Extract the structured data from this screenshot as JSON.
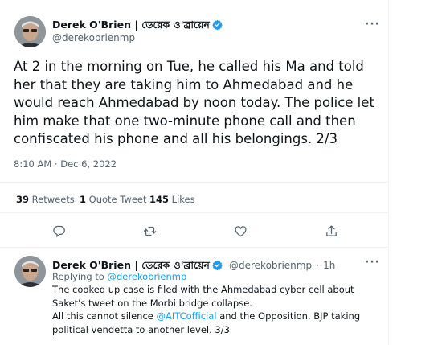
{
  "main_tweet": {
    "author_name": "Derek O'Brien | ডেরেক ও'ব্রায়েন",
    "author_handle": "@derekobrienmp",
    "text": "At 2 in the morning on Tue, he called his Ma and told her that they are taking him to Ahmedabad and he would reach Ahmedabad by noon today. The police let him make that one two-minute phone call and then confiscated his phone and all his belongings. 2/3",
    "timestamp": "8:10 AM · Dec 6, 2022",
    "stats": {
      "retweets_count": "39",
      "retweets_label": "Retweets",
      "quotes_count": "1",
      "quotes_label": "Quote Tweet",
      "likes_count": "145",
      "likes_label": "Likes"
    }
  },
  "actions": [
    "reply-icon",
    "retweet-icon",
    "like-icon",
    "share-icon"
  ],
  "reply_tweet": {
    "author_name": "Derek O'Brien | ডেরেক ও'ব্রায়েন",
    "author_handle": "@derekobrienmp",
    "age": "1h",
    "replying_to_label": "Replying to",
    "replying_to_handle": "@derekobrienmp",
    "text_part1": "The cooked up case is filed with the Ahmedabad cyber cell about Saket's tweet on the Morbi bridge collapse.",
    "text_part2": "All this cannot silence",
    "mention": "@AITCofficial",
    "text_part3": "and the Opposition. BJP taking political vendetta to another level. 3/3"
  },
  "colors": {
    "accent": "#1d9bf0",
    "muted": "#536471",
    "text": "#0f1419",
    "border": "#eff3f4"
  }
}
